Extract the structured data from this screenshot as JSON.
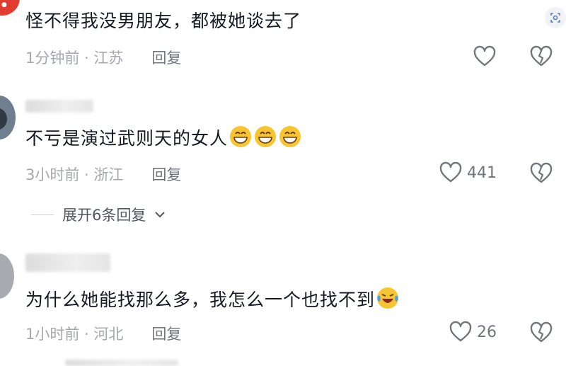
{
  "comments": [
    {
      "text": "怪不得我没男朋友，都被她谈去了",
      "meta": "1分钟前 · 江苏",
      "reply_label": "回复",
      "like_count": "",
      "emoji_count": 0
    },
    {
      "text": "不亏是演过武则天的女人",
      "meta": "3小时前 · 浙江",
      "reply_label": "回复",
      "like_count": "441",
      "emoji_count": 3,
      "expand_label": "展开6条回复"
    },
    {
      "text": "为什么她能找那么多，我怎么一个也找不到",
      "meta": "1小时前 · 河北",
      "reply_label": "回复",
      "like_count": "26",
      "emoji_count": 1
    }
  ],
  "colors": {
    "text": "#161823",
    "meta": "#a5a7ad",
    "icon": "#73757d",
    "emoji": "#f7c531"
  }
}
